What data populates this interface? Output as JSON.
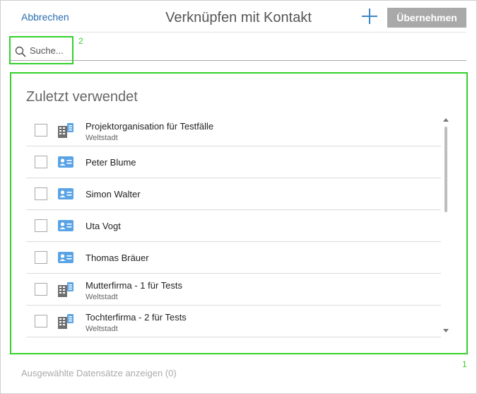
{
  "header": {
    "cancel_label": "Abbrechen",
    "title": "Verknüpfen mit Kontakt",
    "add_icon": "plus-icon",
    "apply_label": "Übernehmen"
  },
  "search": {
    "placeholder": "Suche...",
    "value": "",
    "icon": "search-icon"
  },
  "annotations": {
    "search_marker": "2",
    "list_marker": "1"
  },
  "recent": {
    "title": "Zuletzt verwendet",
    "items": [
      {
        "type": "organization",
        "icon": "building-icon",
        "name": "Projektorganisation für Testfälle",
        "subtitle": "Weltstadt",
        "checked": false
      },
      {
        "type": "contact",
        "icon": "contact-card-icon",
        "name": "Peter Blume",
        "checked": false
      },
      {
        "type": "contact",
        "icon": "contact-card-icon",
        "name": "Simon Walter",
        "checked": false
      },
      {
        "type": "contact",
        "icon": "contact-card-icon",
        "name": "Uta Vogt",
        "checked": false
      },
      {
        "type": "contact",
        "icon": "contact-card-icon",
        "name": "Thomas Bräuer",
        "checked": false
      },
      {
        "type": "organization",
        "icon": "building-icon",
        "name": "Mutterfirma - 1 für Tests",
        "subtitle": "Weltstadt",
        "checked": false
      },
      {
        "type": "organization",
        "icon": "building-icon",
        "name": "Tochterfirma - 2 für Tests",
        "subtitle": "Weltstadt",
        "checked": false
      }
    ]
  },
  "footer": {
    "show_selected_label": "Ausgewählte Datensätze anzeigen (0)"
  },
  "colors": {
    "accent": "#2a6fb0",
    "highlight": "#33d12b",
    "button_disabled": "#a9a9a9",
    "contact_icon": "#5aa3e6"
  }
}
